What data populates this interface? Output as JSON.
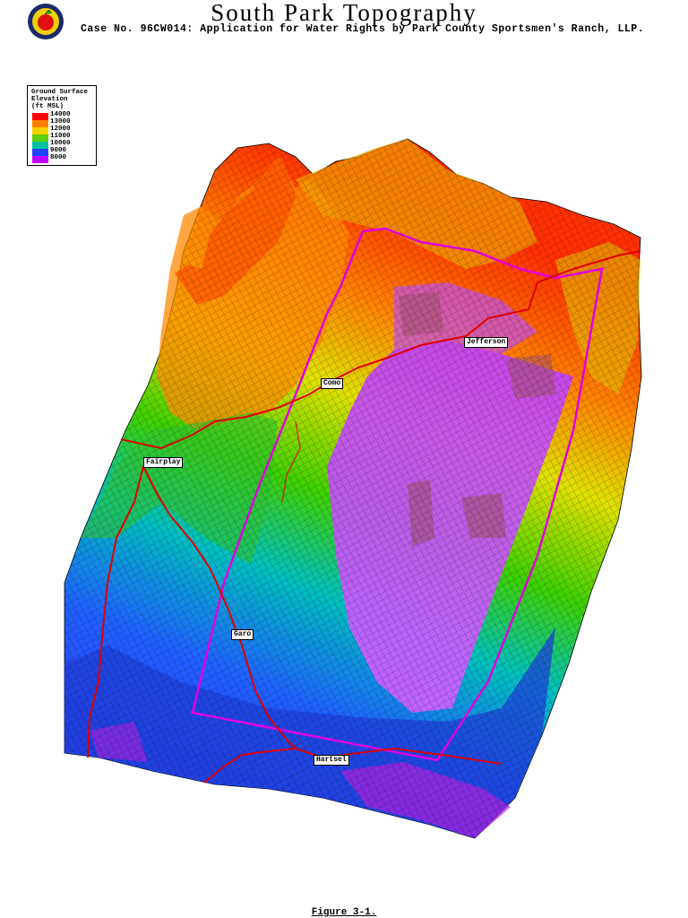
{
  "header": {
    "title": "South Park Topography",
    "subtitle": "Case No. 96CW014: Application for Water Rights by Park County Sportsmen's Ranch, LLP."
  },
  "legend": {
    "title_line1": "Ground Surface",
    "title_line2": "Elevation",
    "title_line3": "(ft MSL)",
    "items": [
      {
        "label": "14000",
        "color": "#ff0000"
      },
      {
        "label": "13000",
        "color": "#ff8000"
      },
      {
        "label": "12000",
        "color": "#ffd000"
      },
      {
        "label": "11000",
        "color": "#60d000"
      },
      {
        "label": "10000",
        "color": "#00c0a0"
      },
      {
        "label": "9000",
        "color": "#2040ff"
      },
      {
        "label": "8000",
        "color": "#c000ff"
      }
    ]
  },
  "towns": {
    "jefferson": "Jefferson",
    "como": "Como",
    "fairplay": "Fairplay",
    "garo": "Garo",
    "hartsel": "Hartsel"
  },
  "caption": "Figure 3-1.",
  "colors": {
    "roads": "#e00000",
    "boundary": "#e000e0"
  }
}
